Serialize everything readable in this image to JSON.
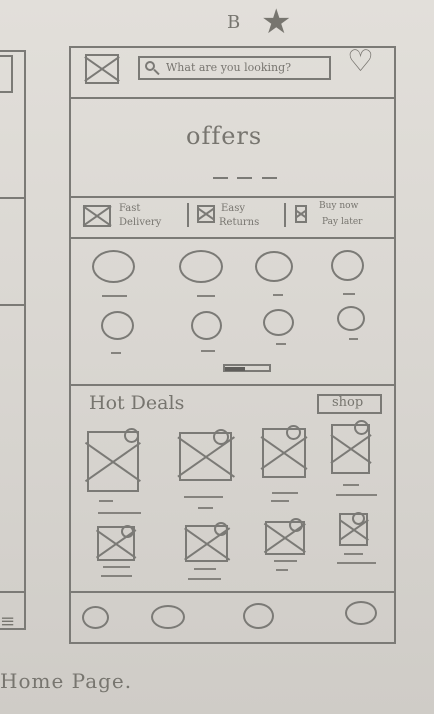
{
  "top_marks": {
    "letter": "B",
    "star": "★"
  },
  "header": {
    "search_placeholder": "What are you looking?"
  },
  "banner": {
    "title": "offers"
  },
  "features": [
    {
      "line1": "Fast",
      "line2": "Delivery"
    },
    {
      "line1": "Easy",
      "line2": "Returns"
    },
    {
      "line1": "Buy now",
      "line2": "Pay later"
    }
  ],
  "hot_deals": {
    "title": "Hot Deals",
    "shop_label": "shop"
  },
  "caption": {
    "text": "Home Page."
  }
}
